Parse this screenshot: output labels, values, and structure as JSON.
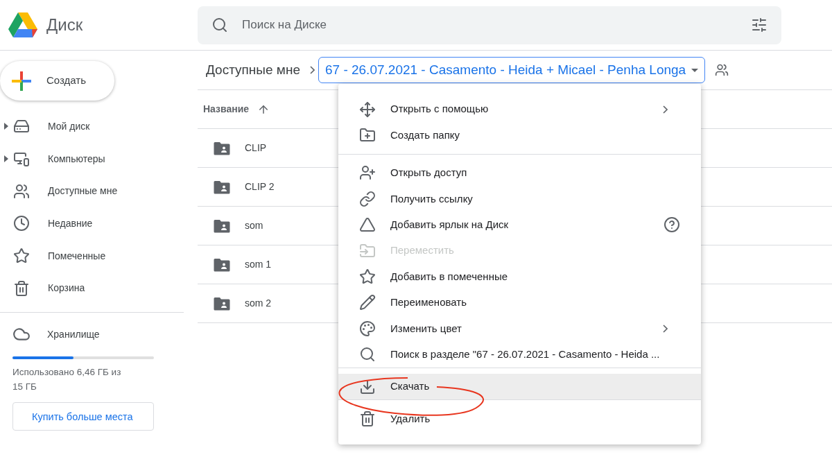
{
  "app": {
    "title": "Диск"
  },
  "search": {
    "placeholder": "Поиск на Диске"
  },
  "create_button": {
    "label": "Создать"
  },
  "sidebar": {
    "items": [
      {
        "label": "Мой диск",
        "expandable": true
      },
      {
        "label": "Компьютеры",
        "expandable": true
      },
      {
        "label": "Доступные мне",
        "expandable": false
      },
      {
        "label": "Недавние",
        "expandable": false
      },
      {
        "label": "Помеченные",
        "expandable": false
      },
      {
        "label": "Корзина",
        "expandable": false
      }
    ]
  },
  "storage": {
    "label": "Хранилище",
    "level": 0.43,
    "usage": "Использовано 6,46 ГБ из 15 ГБ",
    "button": "Купить больше места"
  },
  "breadcrumb": {
    "parent": "Доступные мне",
    "current": "67 - 26.07.2021 - Casamento - Heida + Micael - Penha Longa"
  },
  "table": {
    "column": "Название",
    "rows": [
      {
        "name": "CLIP"
      },
      {
        "name": "CLIP 2"
      },
      {
        "name": "som"
      },
      {
        "name": "som 1"
      },
      {
        "name": "som 2"
      }
    ]
  },
  "context_menu": {
    "groups": [
      [
        {
          "label": "Открыть с помощью",
          "submenu": true,
          "help": false,
          "disabled": false,
          "selected": false
        },
        {
          "label": "Создать папку",
          "submenu": false,
          "help": false,
          "disabled": false,
          "selected": false
        }
      ],
      [
        {
          "label": "Открыть доступ",
          "submenu": false,
          "help": false,
          "disabled": false,
          "selected": false
        },
        {
          "label": "Получить ссылку",
          "submenu": false,
          "help": false,
          "disabled": false,
          "selected": false
        },
        {
          "label": "Добавить ярлык на Диск",
          "submenu": false,
          "help": true,
          "disabled": false,
          "selected": false
        },
        {
          "label": "Переместить",
          "submenu": false,
          "help": false,
          "disabled": true,
          "selected": false
        },
        {
          "label": "Добавить в помеченные",
          "submenu": false,
          "help": false,
          "disabled": false,
          "selected": false
        },
        {
          "label": "Переименовать",
          "submenu": false,
          "help": false,
          "disabled": false,
          "selected": false
        },
        {
          "label": "Изменить цвет",
          "submenu": true,
          "help": false,
          "disabled": false,
          "selected": false
        },
        {
          "label": "Поиск в разделе \"67 - 26.07.2021 - Casamento - Heida ...",
          "submenu": false,
          "help": false,
          "disabled": false,
          "selected": false
        }
      ],
      [
        {
          "label": "Скачать",
          "submenu": false,
          "help": false,
          "disabled": false,
          "selected": true
        }
      ],
      [
        {
          "label": "Удалить",
          "submenu": false,
          "help": false,
          "disabled": false,
          "selected": false
        }
      ]
    ]
  }
}
